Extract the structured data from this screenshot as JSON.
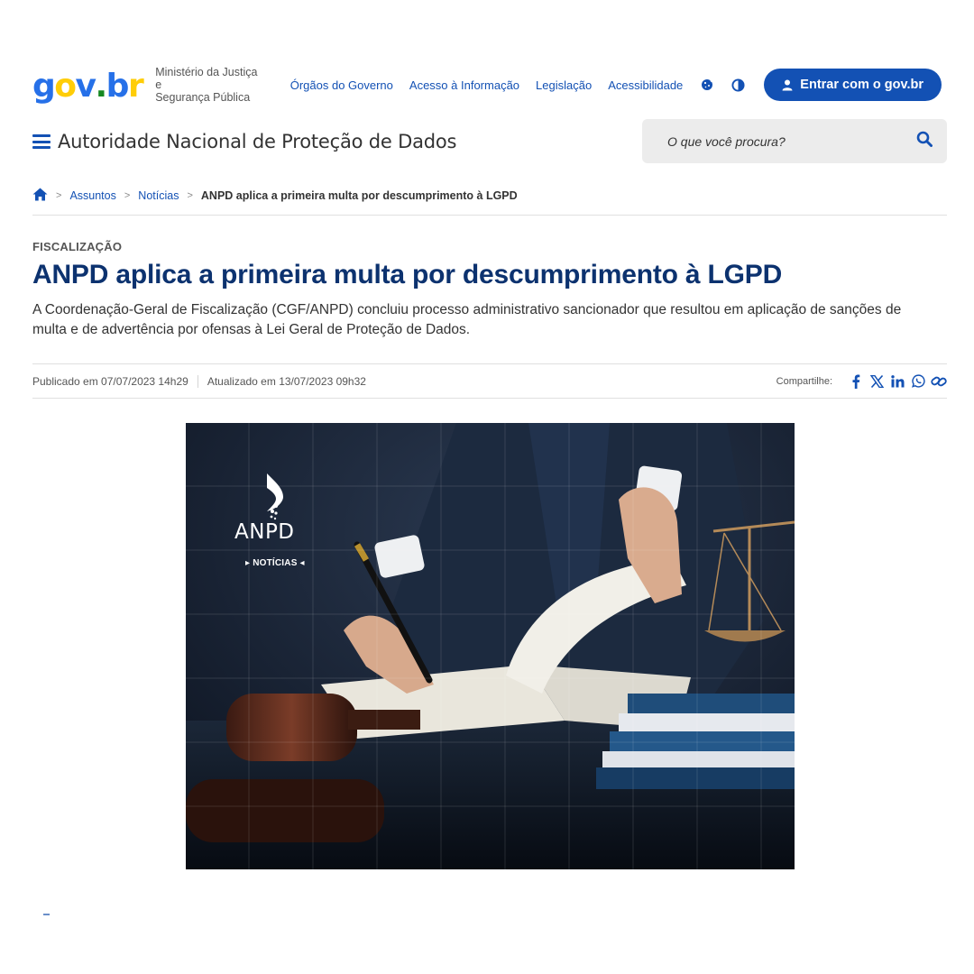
{
  "header": {
    "logo": {
      "g": "g",
      "o": "o",
      "v": "v",
      "dot": ".",
      "b": "b",
      "r": "r"
    },
    "ministry_line1": "Ministério da Justiça e",
    "ministry_line2": "Segurança Pública",
    "nav": [
      "Órgãos do Governo",
      "Acesso à Informação",
      "Legislação",
      "Acessibilidade"
    ],
    "tools": [
      "cookie-icon",
      "contrast-icon"
    ],
    "login": {
      "label": "Entrar com o",
      "brand": "gov.br",
      "icon": "user-icon"
    },
    "brand_color": "#1351b4"
  },
  "site": {
    "title": "Autoridade Nacional de Proteção de Dados",
    "search_placeholder": "O que você procura?"
  },
  "breadcrumb": {
    "home_icon": "home-icon",
    "items": [
      "Assuntos",
      "Notícias"
    ],
    "current": "ANPD aplica a primeira multa por descumprimento à LGPD"
  },
  "article": {
    "kicker": "FISCALIZAÇÃO",
    "title": "ANPD aplica a primeira multa por descumprimento à LGPD",
    "lead": "A Coordenação-Geral de Fiscalização (CGF/ANPD) concluiu processo administrativo sancionador que resultou em aplicação de sanções de multa e de advertência por ofensas à Lei Geral de Proteção de Dados.",
    "published": "Publicado em 07/07/2023 14h29",
    "updated": "Atualizado em 13/07/2023 09h32",
    "share_label": "Compartilhe:",
    "share_icons": [
      "facebook-icon",
      "x-icon",
      "linkedin-icon",
      "whatsapp-icon",
      "link-icon"
    ],
    "title_color": "#0c326f"
  },
  "hero": {
    "brand": "ANPD",
    "tag": "▸ NOTÍCIAS ◂"
  }
}
